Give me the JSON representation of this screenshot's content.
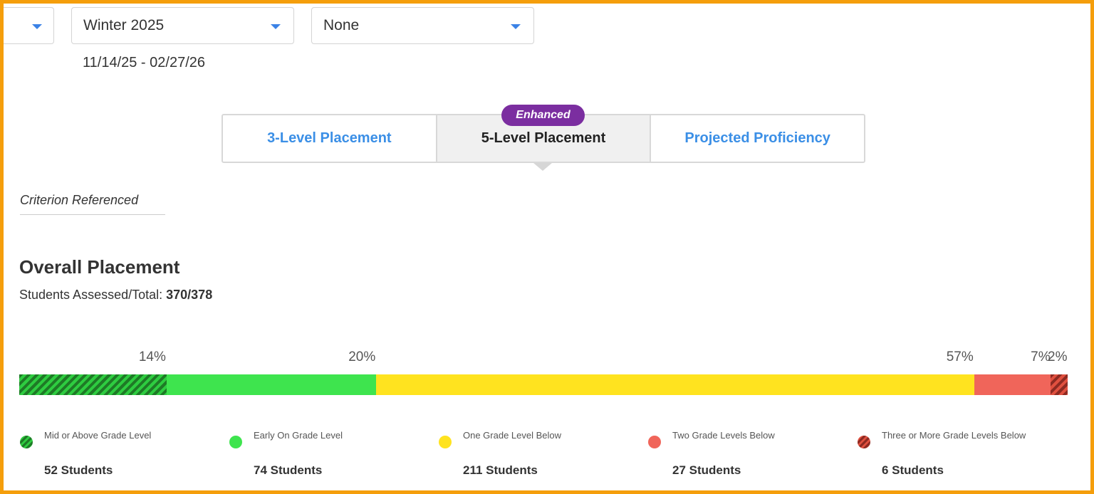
{
  "filters": {
    "select_1": {
      "value": ""
    },
    "term": {
      "value": "Winter 2025"
    },
    "group": {
      "value": "None"
    },
    "date_range": "11/14/25 - 02/27/26"
  },
  "tabs": [
    {
      "label": "3-Level Placement",
      "active": false
    },
    {
      "label": "5-Level Placement",
      "active": true,
      "badge": "Enhanced"
    },
    {
      "label": "Projected Proficiency",
      "active": false
    }
  ],
  "criterion_label": "Criterion Referenced",
  "section": {
    "title": "Overall Placement",
    "assessed_label": "Students Assessed/Total:",
    "assessed_value": "370/378"
  },
  "placement": [
    {
      "label": "Mid or Above Grade Level",
      "percent_text": "14%",
      "percent": 14.05,
      "students": "52 Students",
      "color": "#2ecc40",
      "hatch": "#1e7a26",
      "pattern": "hatched"
    },
    {
      "label": "Early On Grade Level",
      "percent_text": "20%",
      "percent": 20.0,
      "students": "74 Students",
      "color": "#3ee44e",
      "pattern": "solid"
    },
    {
      "label": "One Grade Level Below",
      "percent_text": "57%",
      "percent": 57.03,
      "students": "211 Students",
      "color": "#ffe31f",
      "pattern": "solid"
    },
    {
      "label": "Two Grade Levels Below",
      "percent_text": "7%",
      "percent": 7.3,
      "students": "27 Students",
      "color": "#f0655a",
      "pattern": "solid"
    },
    {
      "label": "Three or More Grade Levels Below",
      "percent_text": "2%",
      "percent": 1.62,
      "students": "6 Students",
      "color": "#e0503f",
      "hatch": "#8e2a22",
      "pattern": "hatched"
    }
  ],
  "colors": {
    "accent": "#3b8fe6",
    "badge": "#7b2ea0",
    "frame": "#f59e0b"
  }
}
